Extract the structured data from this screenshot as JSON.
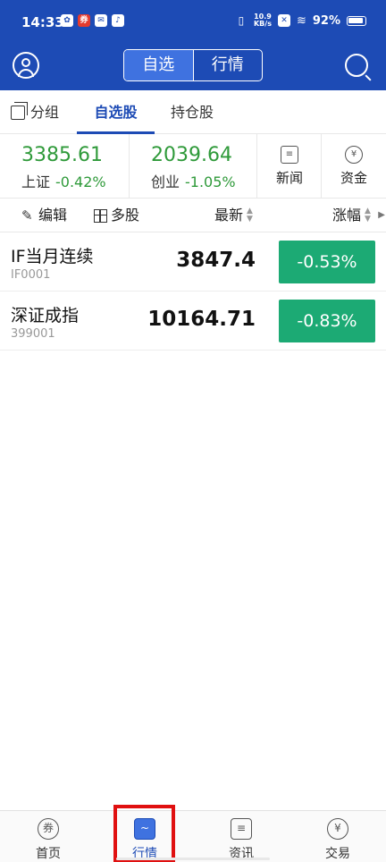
{
  "status_bar": {
    "time": "14:33",
    "net_speed_top": "10.9",
    "net_speed_unit": "KB/s",
    "battery": "92%"
  },
  "header": {
    "tabs": [
      {
        "label": "自选",
        "active": true
      },
      {
        "label": "行情",
        "active": false
      }
    ]
  },
  "subtabs": {
    "group": "分组",
    "watchlist": "自选股",
    "holdings": "持仓股"
  },
  "indices": [
    {
      "value": "3385.61",
      "name": "上证",
      "change": "-0.42%"
    },
    {
      "value": "2039.64",
      "name": "创业",
      "change": "-1.05%"
    }
  ],
  "shortcuts": {
    "news": "新闻",
    "fund": "资金",
    "fund_icon_char": "¥"
  },
  "toolbar": {
    "edit": "编辑",
    "multi": "多股",
    "latest": "最新",
    "change": "涨幅"
  },
  "quotes": [
    {
      "name": "IF当月连续",
      "code": "IF0001",
      "price": "3847.4",
      "change": "-0.53%"
    },
    {
      "name": "深证成指",
      "code": "399001",
      "price": "10164.71",
      "change": "-0.83%"
    }
  ],
  "bottom_nav": [
    {
      "label": "首页",
      "icon": "券"
    },
    {
      "label": "行情",
      "icon": "~",
      "active": true
    },
    {
      "label": "资讯",
      "icon": "≡"
    },
    {
      "label": "交易",
      "icon": "¥"
    }
  ],
  "colors": {
    "brand_blue": "#1d4bb5",
    "fall_green": "#2f9a3a",
    "change_badge_green": "#1caa74",
    "highlight_red": "#e01010"
  }
}
